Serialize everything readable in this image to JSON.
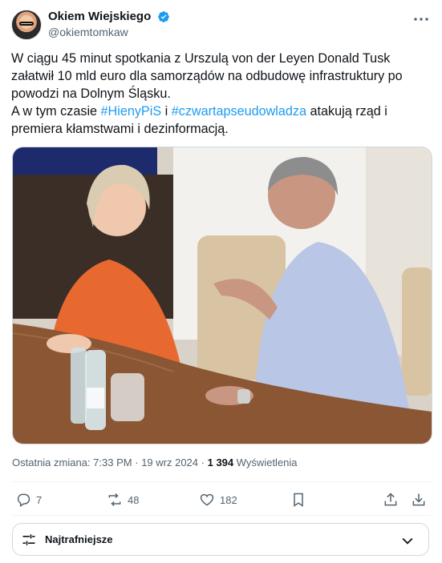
{
  "author": {
    "display_name": "Okiem Wiejskiego",
    "handle": "@okiemtomkaw",
    "verified_icon": "verified-badge-icon",
    "avatar_icon": "avatar"
  },
  "tweet": {
    "segments": [
      {
        "text": "W ciągu 45 minut spotkania z Urszulą von der Leyen Donald Tusk załatwił 10 mld euro dla samorządów na odbudowę infrastruktury po powodzi na Dolnym Śląsku.\nA w tym czasie ",
        "hashtag": false
      },
      {
        "text": "#HienyPiS",
        "hashtag": true
      },
      {
        "text": " i ",
        "hashtag": false
      },
      {
        "text": "#czwartapseudowladza",
        "hashtag": false,
        "note": ""
      },
      {
        "text": " atakują rząd i premiera kłamstwami i dezinformacją.",
        "hashtag": false
      }
    ]
  },
  "meta": {
    "edited_label": "Ostatnia zmiana:",
    "time": "7:33 PM",
    "separator": "·",
    "date": "19 wrz 2024",
    "dot": "·",
    "views_count": "1 394",
    "views_label": "Wyświetlenia"
  },
  "actions": {
    "replies": "7",
    "reposts": "48",
    "likes": "182"
  },
  "sort": {
    "label": "Najtrafniejsze"
  },
  "colors": {
    "accent": "#1d9bf0",
    "text": "#0f1419",
    "muted": "#536471",
    "border": "#cfd9de"
  }
}
